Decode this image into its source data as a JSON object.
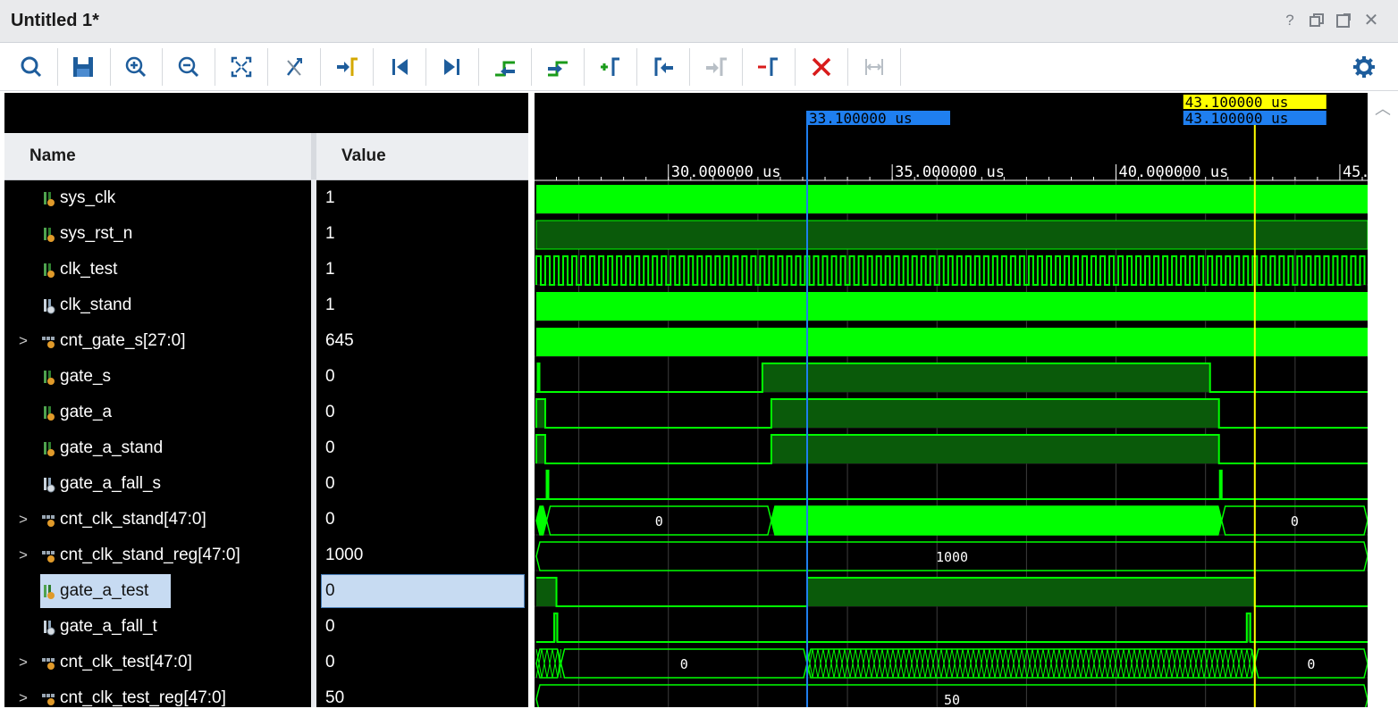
{
  "window": {
    "title": "Untitled 1*",
    "buttons": [
      "help",
      "restore",
      "maximize",
      "close"
    ],
    "help_label": "?",
    "close_label": "✕"
  },
  "toolbar": {
    "icons": [
      "search-icon",
      "save-icon",
      "zoom-in-icon",
      "zoom-out-icon",
      "zoom-fit-icon",
      "swap-cursor-icon",
      "go-to-cursor-icon",
      "go-to-time-zero-icon",
      "go-to-last-time-icon",
      "previous-transition-icon",
      "next-transition-icon",
      "add-marker-icon",
      "previous-marker-icon",
      "next-marker-icon",
      "delete-marker-icon",
      "delete-all-markers-icon",
      "snap-to-transition-icon",
      "settings-icon"
    ]
  },
  "columns": {
    "name": "Name",
    "value": "Value"
  },
  "signals": [
    {
      "name": "sys_clk",
      "value": "1",
      "bus": false,
      "icon": "input-port-icon"
    },
    {
      "name": "sys_rst_n",
      "value": "1",
      "bus": false,
      "icon": "input-port-icon"
    },
    {
      "name": "clk_test",
      "value": "1",
      "bus": false,
      "icon": "input-port-icon"
    },
    {
      "name": "clk_stand",
      "value": "1",
      "bus": false,
      "icon": "wire-icon"
    },
    {
      "name": "cnt_gate_s[27:0]",
      "value": "645",
      "bus": true,
      "icon": "bus-icon"
    },
    {
      "name": "gate_s",
      "value": "0",
      "bus": false,
      "icon": "input-port-icon"
    },
    {
      "name": "gate_a",
      "value": "0",
      "bus": false,
      "icon": "input-port-icon"
    },
    {
      "name": "gate_a_stand",
      "value": "0",
      "bus": false,
      "icon": "input-port-icon"
    },
    {
      "name": "gate_a_fall_s",
      "value": "0",
      "bus": false,
      "icon": "wire-icon"
    },
    {
      "name": "cnt_clk_stand[47:0]",
      "value": "0",
      "bus": true,
      "icon": "bus-icon"
    },
    {
      "name": "cnt_clk_stand_reg[47:0]",
      "value": "1000",
      "bus": true,
      "icon": "bus-icon"
    },
    {
      "name": "gate_a_test",
      "value": "0",
      "bus": false,
      "icon": "input-port-icon",
      "selected": true
    },
    {
      "name": "gate_a_fall_t",
      "value": "0",
      "bus": false,
      "icon": "wire-icon"
    },
    {
      "name": "cnt_clk_test[47:0]",
      "value": "0",
      "bus": true,
      "icon": "bus-icon"
    },
    {
      "name": "cnt_clk_test_reg[47:0]",
      "value": "50",
      "bus": true,
      "icon": "bus-icon"
    }
  ],
  "timeline": {
    "ticks": [
      {
        "t": 30,
        "label": "30.000000 us"
      },
      {
        "t": 35,
        "label": "35.000000 us"
      },
      {
        "t": 40,
        "label": "40.000000 us"
      },
      {
        "t": 45,
        "label": "45.000000 us"
      }
    ],
    "range_us": [
      27.05,
      45.62
    ],
    "cursors": [
      {
        "time": 33.1,
        "label": "33.100000 us",
        "color": "#1f7ff0"
      },
      {
        "time": 43.1,
        "label": "43.100000 us",
        "color": "#ffff00"
      }
    ],
    "marker_label": "43.100000 us"
  },
  "waves": [
    {
      "type": "dense"
    },
    {
      "type": "high"
    },
    {
      "type": "clock",
      "period_us": 0.2
    },
    {
      "type": "dense"
    },
    {
      "type": "dense"
    },
    {
      "type": "digital",
      "initial": 0,
      "edges": [
        {
          "t": 27.08,
          "v": 1
        },
        {
          "t": 27.12,
          "v": 0
        },
        {
          "t": 32.1,
          "v": 1
        },
        {
          "t": 42.1,
          "v": 0
        }
      ]
    },
    {
      "type": "digital",
      "initial": 0,
      "edges": [
        {
          "t": 27.05,
          "v": 1
        },
        {
          "t": 27.25,
          "v": 0
        },
        {
          "t": 32.3,
          "v": 1
        },
        {
          "t": 42.3,
          "v": 0
        }
      ]
    },
    {
      "type": "digital",
      "initial": 0,
      "edges": [
        {
          "t": 27.05,
          "v": 1
        },
        {
          "t": 27.25,
          "v": 0
        },
        {
          "t": 32.3,
          "v": 1
        },
        {
          "t": 42.3,
          "v": 0
        }
      ]
    },
    {
      "type": "digital",
      "initial": 0,
      "edges": [
        {
          "t": 27.28,
          "v": 1
        },
        {
          "t": 27.32,
          "v": 0
        },
        {
          "t": 42.32,
          "v": 1
        },
        {
          "t": 42.36,
          "v": 0
        }
      ]
    },
    {
      "type": "bus",
      "segments": [
        {
          "from": 27.05,
          "to": 27.28,
          "label": "",
          "fill": true
        },
        {
          "from": 27.28,
          "to": 32.3,
          "label": "0",
          "fill": false
        },
        {
          "from": 32.3,
          "to": 42.36,
          "label": "",
          "fill": true
        },
        {
          "from": 42.36,
          "to": 45.62,
          "label": "0",
          "fill": false
        }
      ]
    },
    {
      "type": "bus",
      "segments": [
        {
          "from": 27.05,
          "to": 45.62,
          "label": "1000",
          "fill": false
        }
      ]
    },
    {
      "type": "digital",
      "initial": 1,
      "edges": [
        {
          "t": 27.5,
          "v": 0
        },
        {
          "t": 33.1,
          "v": 1
        },
        {
          "t": 43.1,
          "v": 0
        }
      ]
    },
    {
      "type": "digital",
      "initial": 0,
      "edges": [
        {
          "t": 27.45,
          "v": 1
        },
        {
          "t": 27.52,
          "v": 0
        },
        {
          "t": 42.92,
          "v": 1
        },
        {
          "t": 43.0,
          "v": 0
        }
      ]
    },
    {
      "type": "bus",
      "segments": [
        {
          "from": 27.05,
          "to": 27.6,
          "label": "",
          "fill": false,
          "xhatch": true
        },
        {
          "from": 27.6,
          "to": 33.1,
          "label": "0",
          "fill": false
        },
        {
          "from": 33.1,
          "to": 43.1,
          "label": "",
          "fill": false,
          "xhatch": true
        },
        {
          "from": 43.1,
          "to": 45.62,
          "label": "0",
          "fill": false
        }
      ]
    },
    {
      "type": "bus",
      "segments": [
        {
          "from": 27.05,
          "to": 45.62,
          "label": "50",
          "fill": false
        }
      ]
    }
  ],
  "colors": {
    "wave": "#00ff00",
    "wave_dim": "#0a5a0a",
    "grid": "#3d3d3d",
    "background": "#000000",
    "tick_text": "#ffffff"
  }
}
